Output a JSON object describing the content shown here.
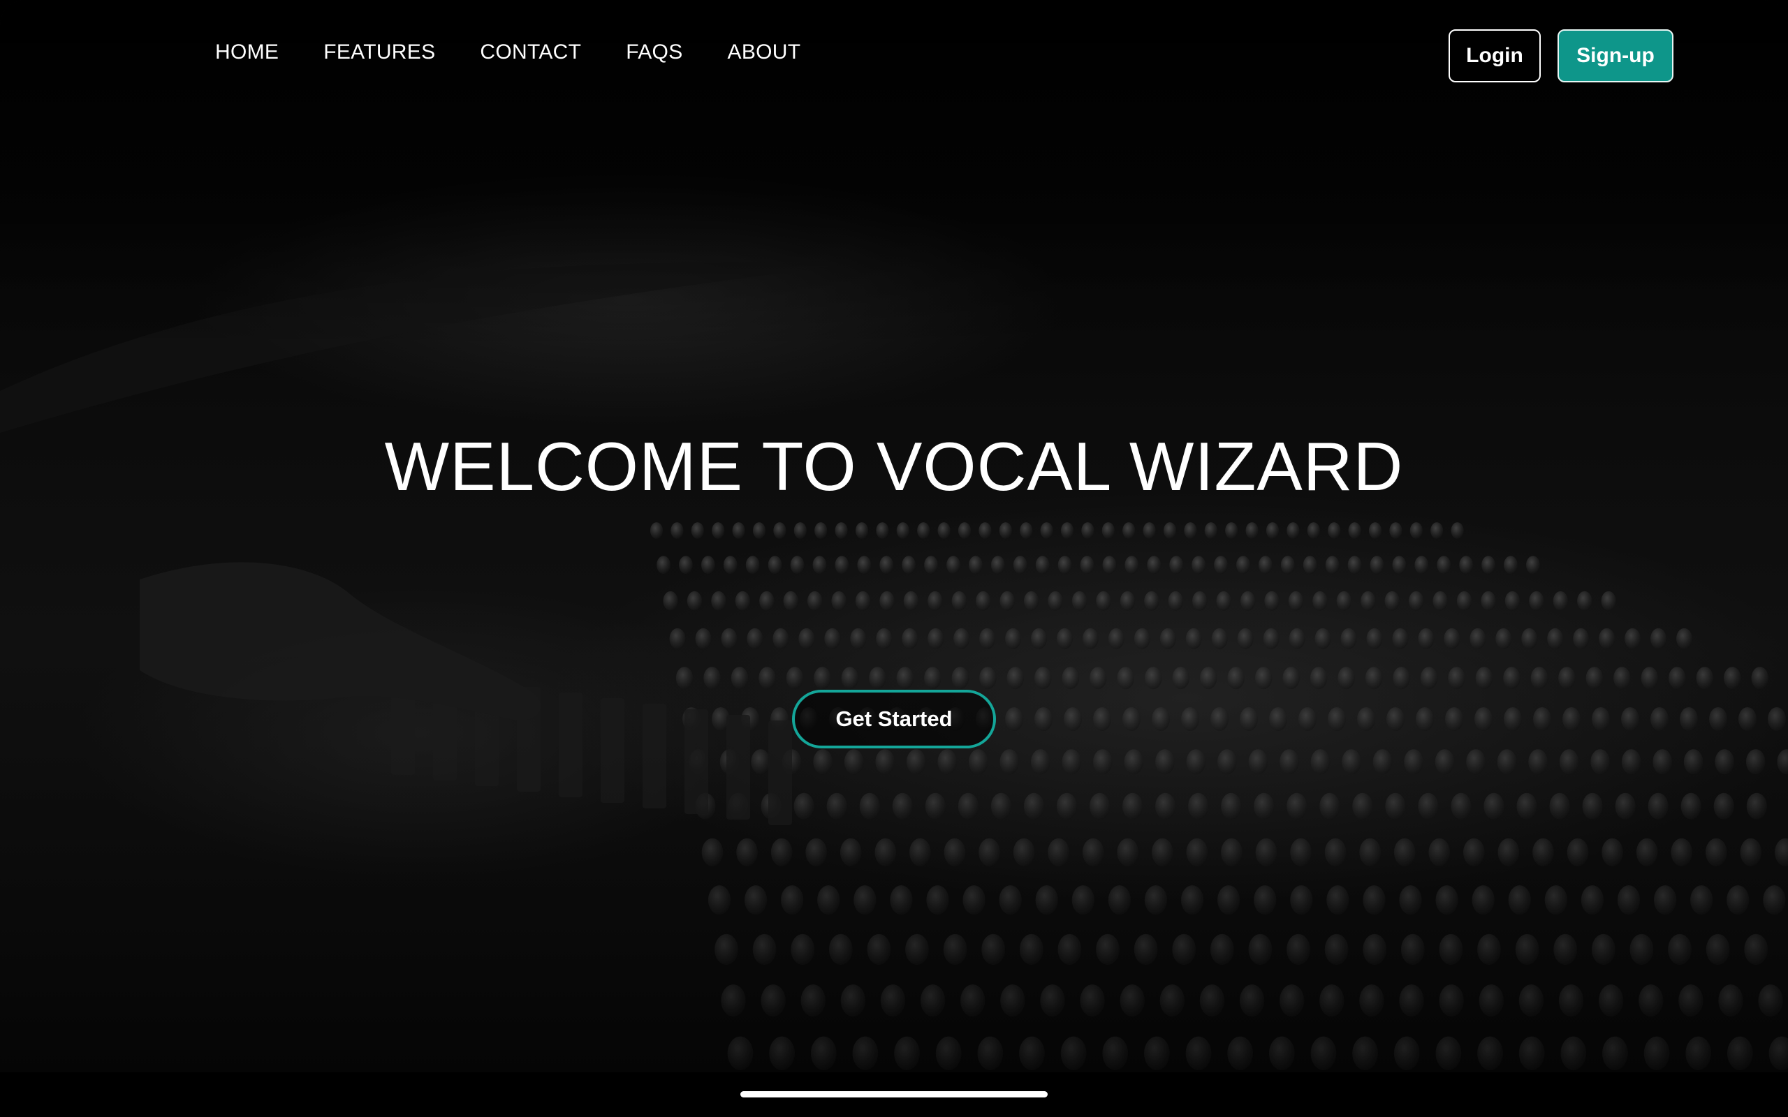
{
  "nav": {
    "items": [
      {
        "label": "HOME"
      },
      {
        "label": "FEATURES"
      },
      {
        "label": "CONTACT"
      },
      {
        "label": "FAQS"
      },
      {
        "label": "ABOUT"
      }
    ]
  },
  "auth": {
    "login_label": "Login",
    "signup_label": "Sign-up"
  },
  "hero": {
    "title": "WELCOME TO VOCAL WIZARD",
    "cta_label": "Get Started",
    "background_image": "mixing-console-photo"
  },
  "colors": {
    "accent": "#0e968a",
    "cta_border": "#14a699",
    "background": "#050505",
    "text": "#ffffff"
  }
}
